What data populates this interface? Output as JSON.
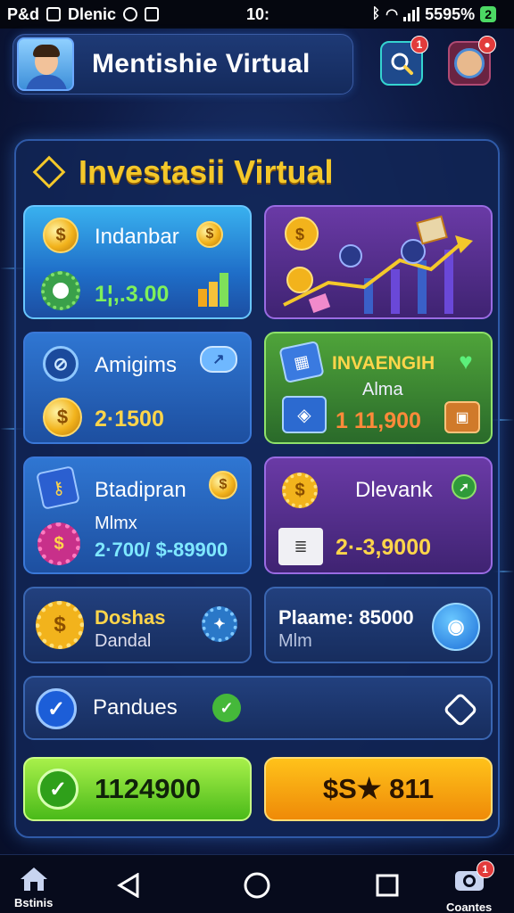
{
  "status_bar": {
    "left_text": "P&d",
    "app_text": "Dlenic",
    "center_text": "10:",
    "battery_text": "5595%",
    "battery_level": "2",
    "icons": [
      "bluetooth-icon",
      "wifi-icon",
      "signal-icon",
      "battery-icon"
    ]
  },
  "header": {
    "title": "Mentishie Virtual",
    "search_badge": "1",
    "profile_badge": "●"
  },
  "panel": {
    "title": "Investasii Virtual"
  },
  "cards": [
    {
      "label": "Indanbar",
      "value": "1¦,.3.00"
    },
    {
      "label": "Amigims",
      "value": "2·1500"
    },
    {
      "label": "INVAENGIH",
      "sublabel": "Alma",
      "value": "1 11,900"
    },
    {
      "label": "Btadipran",
      "sublabel": "Mlmx",
      "value": "2·700/ $-89900"
    },
    {
      "label": "Dlevank",
      "value": "2·-3,9000"
    },
    {
      "label": "Doshas",
      "sublabel": "Dandal"
    },
    {
      "label": "Plaame: 85000",
      "sublabel": "Mlm"
    },
    {
      "label": "Pandues"
    }
  ],
  "actions": {
    "primary_value": "1124900",
    "secondary_value": "$S★ 811"
  },
  "nav": {
    "home_label": "Bstinis",
    "camera_label": "Coantes",
    "camera_badge": "1"
  },
  "colors": {
    "accent_gold": "#f4c82a",
    "primary_green": "#5bc41f",
    "secondary_orange": "#f39a0c",
    "badge_red": "#e23b3b"
  }
}
